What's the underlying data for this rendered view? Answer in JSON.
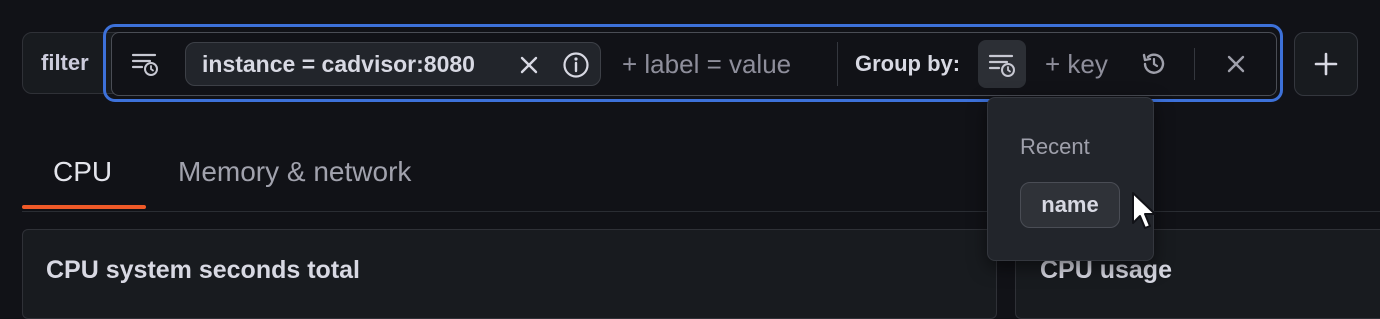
{
  "filter_bar": {
    "label": "filter",
    "chip": {
      "text": "instance = cadvisor:8080"
    },
    "label_placeholder": "+ label = value",
    "group_by_label": "Group by:",
    "key_placeholder": "+ key"
  },
  "tabs": [
    {
      "label": "CPU",
      "active": true
    },
    {
      "label": "Memory & network",
      "active": false
    }
  ],
  "panels": [
    {
      "title": "CPU system seconds total"
    },
    {
      "title": "CPU usage"
    }
  ],
  "popover": {
    "section_label": "Recent",
    "items": [
      {
        "label": "name"
      }
    ]
  },
  "icons": {
    "filter_toggle": "filter-history-icon",
    "chip_remove": "close-icon",
    "chip_info": "info-icon",
    "group_by": "filter-history-icon",
    "recent": "history-icon",
    "clear": "close-icon",
    "add": "plus-icon"
  },
  "colors": {
    "accent_focus": "#3d71d9",
    "tab_active_underline": "#f05a28",
    "background": "#111217"
  }
}
